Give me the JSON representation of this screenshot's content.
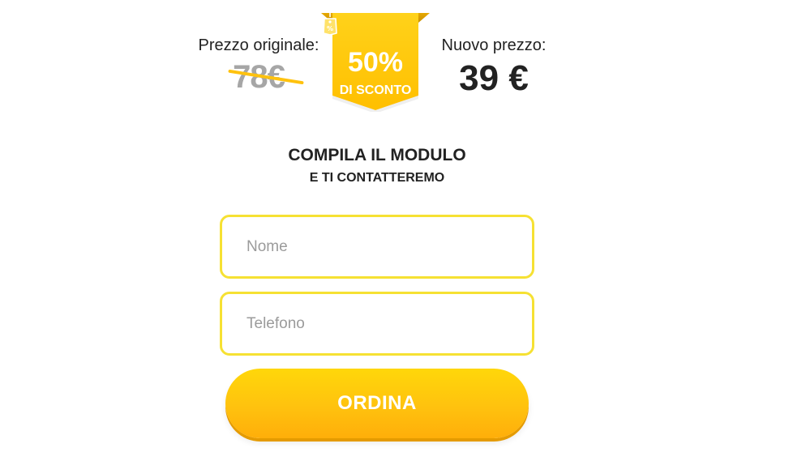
{
  "pricing": {
    "original_caption": "Prezzo originale:",
    "original_value": "78€",
    "new_caption": "Nuovo prezzo:",
    "new_value": "39 €"
  },
  "discount": {
    "percent": "50%",
    "label": "DI SCONTO",
    "icon": "percent-tag-icon"
  },
  "form": {
    "heading": "COMPILA IL MODULO",
    "subheading": "E TI CONTATTEREMO",
    "name_placeholder": "Nome",
    "phone_placeholder": "Telefono",
    "submit_label": "ORDINA"
  },
  "colors": {
    "accent": "#ffc20e",
    "field_border": "#f6e133",
    "old_price": "#a6a6a6",
    "text": "#222222"
  }
}
